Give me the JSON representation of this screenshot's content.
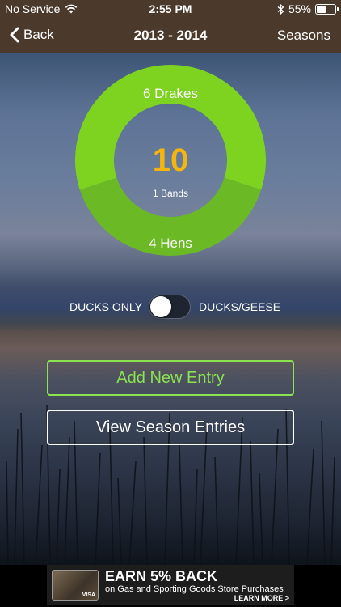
{
  "status": {
    "carrier": "No Service",
    "time": "2:55 PM",
    "battery": "55%",
    "battery_level": 0.55
  },
  "nav": {
    "back_label": "Back",
    "title": "2013 - 2014",
    "seasons_label": "Seasons"
  },
  "summary": {
    "drakes_label": "6 Drakes",
    "hens_label": "4 Hens",
    "total": "10",
    "bands_label": "1 Bands",
    "drakes_count": 6,
    "hens_count": 4,
    "colors": {
      "drakes": "#7ed321",
      "hens": "#6bba25",
      "total": "#f6b40f"
    }
  },
  "toggle": {
    "left_label": "DUCKS ONLY",
    "right_label": "DUCKS/GEESE",
    "state": "off"
  },
  "actions": {
    "add_label": "Add New Entry",
    "view_label": "View Season Entries",
    "add_color": "#8be34f"
  },
  "ad": {
    "title": "EARN 5% BACK",
    "subtitle": "on Gas and Sporting Goods Store Purchases",
    "cta": "LEARN MORE >",
    "card_brand": "VISA"
  }
}
